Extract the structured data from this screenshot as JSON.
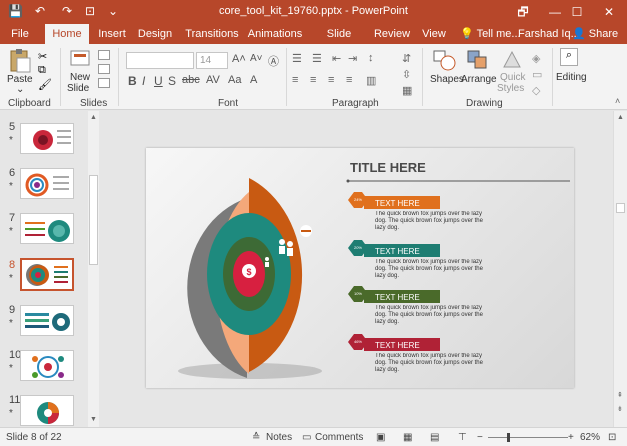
{
  "window": {
    "title": "core_tool_kit_19760.pptx - PowerPoint",
    "controls": [
      "🗗",
      "—",
      "☐",
      "✕"
    ]
  },
  "tabs": [
    "File",
    "Home",
    "Insert",
    "Design",
    "Transitions",
    "Animations",
    "Slide Show",
    "Review",
    "View"
  ],
  "tell_me": "Tell me...",
  "user": "Farshad Iq...",
  "share": "Share",
  "ribbon": {
    "paste": "Paste",
    "new_slide_1": "New",
    "new_slide_2": "Slide",
    "font_size": "14",
    "shapes": "Shapes",
    "arrange": "Arrange",
    "quick_styles_1": "Quick",
    "quick_styles_2": "Styles",
    "editing": "Editing",
    "groups": {
      "clipboard": "Clipboard",
      "slides": "Slides",
      "font": "Font",
      "paragraph": "Paragraph",
      "drawing": "Drawing"
    }
  },
  "thumbnails": [
    {
      "num": "5",
      "star": "*"
    },
    {
      "num": "6",
      "star": "*"
    },
    {
      "num": "7",
      "star": "*"
    },
    {
      "num": "8",
      "star": "*"
    },
    {
      "num": "9",
      "star": "*"
    },
    {
      "num": "10",
      "star": "*"
    },
    {
      "num": "11",
      "star": "*"
    }
  ],
  "slide": {
    "title": "TITLE HERE",
    "items": [
      {
        "pct": "24%",
        "heading": "TEXT HERE",
        "body": "The quick brown fox jumps over the lazy dog. The quick brown fox jumps over the lazy dog.",
        "color": "#e0701d"
      },
      {
        "pct": "20%",
        "heading": "TEXT HERE",
        "body": "The quick brown fox jumps over the lazy dog. The quick brown fox jumps over the lazy dog.",
        "color": "#1e7d72"
      },
      {
        "pct": "10%",
        "heading": "TEXT HERE",
        "body": "The quick brown fox jumps over the lazy dog. The quick brown fox jumps over the lazy dog.",
        "color": "#4a6a2a"
      },
      {
        "pct": "46%",
        "heading": "TEXT HERE",
        "body": "The quick brown fox jumps over the lazy dog. The quick brown fox jumps over the lazy dog.",
        "color": "#b02236"
      }
    ],
    "money_symbol": "$"
  },
  "status": {
    "slide_info": "Slide 8 of 22",
    "notes": "Notes",
    "comments": "Comments",
    "zoom": "62%",
    "minus": "−",
    "plus": "+"
  },
  "colors": {
    "accent": "#b7472a",
    "ring_gray": "#7a7a7a",
    "ring_peach": "#f4a87a",
    "ring_orange": "#c85a12",
    "ring_teal": "#1e8a7e",
    "ring_green": "#3d6a35",
    "core_red": "#d72040"
  }
}
